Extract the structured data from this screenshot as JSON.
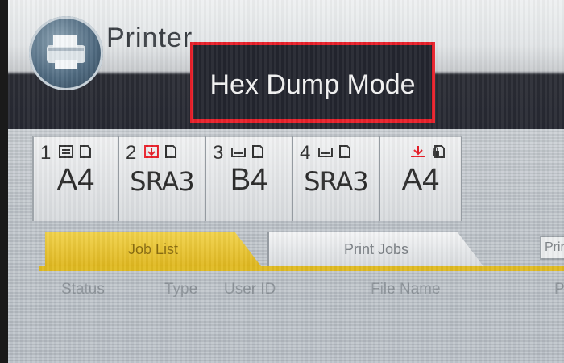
{
  "header": {
    "app_title": "Printer",
    "mode_label": "Hex Dump Mode"
  },
  "trays": [
    {
      "number": "1",
      "size": "A4",
      "selected": false
    },
    {
      "number": "2",
      "size": "SRA3",
      "selected": false
    },
    {
      "number": "3",
      "size": "B4",
      "selected": false
    },
    {
      "number": "4",
      "size": "SRA3",
      "selected": false
    },
    {
      "number": "",
      "size": "A4",
      "selected": false
    }
  ],
  "tabs": [
    {
      "label": "Job List",
      "active": true
    },
    {
      "label": "Print Jobs",
      "active": false
    },
    {
      "label": "Prin",
      "active": false
    }
  ],
  "job_list": {
    "columns": [
      "Status",
      "Type",
      "User ID",
      "File Name",
      "P"
    ]
  },
  "colors": {
    "accent_yellow": "#e0b820",
    "highlight_red": "#e8202a",
    "header_dark": "#262832"
  }
}
